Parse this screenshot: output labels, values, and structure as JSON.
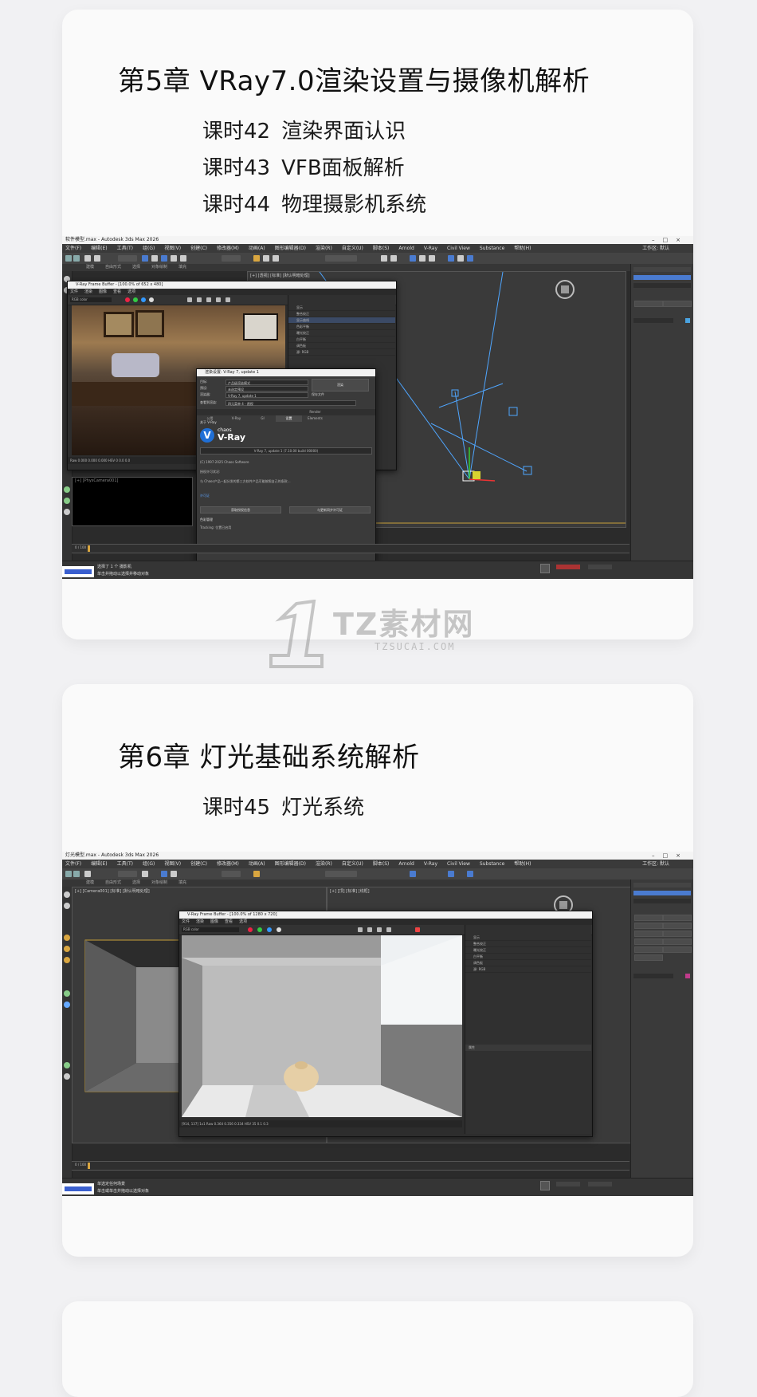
{
  "chapter5": {
    "title": "第5章 VRay7.0渲染设置与摄像机解析",
    "lessons": [
      {
        "num": "课时42",
        "name": "渲染界面认识"
      },
      {
        "num": "课时43",
        "name": "VFB面板解析"
      },
      {
        "num": "课时44",
        "name": "物理摄影机系统"
      }
    ],
    "screenshot": {
      "window_title": "软件模型.max - Autodesk 3ds Max 2026",
      "menu": [
        "文件(F)",
        "编辑(E)",
        "工具(T)",
        "组(G)",
        "视图(V)",
        "创建(C)",
        "修改器(M)",
        "动画(A)",
        "图形编辑器(D)",
        "渲染(R)",
        "自定义(U)",
        "脚本(S)",
        "Arnold",
        "V-Ray",
        "Civil View",
        "Substance",
        "帮助(H)"
      ],
      "workspace": "工作区: 默认",
      "subtabs": [
        "建模",
        "自由形式",
        "选择",
        "对象绘制",
        "填充"
      ],
      "vfb": {
        "title": "V-Ray Frame Buffer - [100.0% of 652 x 480]",
        "menu": [
          "文件",
          "渲染",
          "图像",
          "查看",
          "选项"
        ],
        "rgb": "RGB color",
        "layers": [
          "显示",
          "整合校正",
          "显示曲线",
          "色彩平衡",
          "曝光校正",
          "白平衡",
          "调色板",
          "源: RGB"
        ],
        "status": "Raw  0.000  0.000  0.000  HSV  0  0.0  0.0"
      },
      "render_dialog": {
        "title": "渲染设置: V-Ray 7, update 1",
        "target_label": "目标:",
        "target": "产品级渲染模式",
        "preset_label": "预设:",
        "preset": "未选定预设",
        "renderer_label": "渲染器:",
        "renderer": "V-Ray 7, update 1",
        "save_file": "保存文件",
        "view_label": "查看到渲染:",
        "view": "四元菜单 4 - 透视",
        "render_button": "渲染",
        "tabs": [
          "公用",
          "V-Ray",
          "GI",
          "设置",
          "Render Elements"
        ],
        "about_header": "关于 V-Ray",
        "logo_small": "chaos",
        "logo_big": "V-Ray",
        "version": "V-Ray 7, update 1 (7.10.00 build 00000)",
        "copyright": "(C) 1997-2025 Chaos Software",
        "license_title": "授权许可状况:",
        "license_text": "与 Chaos产品一起分发的第三方软件产品可能按照自己的条款…",
        "license_link": "许可证",
        "btn_left": "获取授权信息",
        "btn_right": "与更新同步许可证",
        "color_mgmt": "色彩管理",
        "tracing": "Tracking: 位置已启用"
      },
      "status": {
        "line1": "选择了 1 个 摄影机",
        "line2": "单击并拖动以选择并移动对象",
        "maxscript": "MAXScript 迷你侦听器",
        "timeline_start": "0 / 100"
      }
    }
  },
  "chapter6": {
    "title": "第6章 灯光基础系统解析",
    "lessons": [
      {
        "num": "课时45",
        "name": "灯光系统"
      }
    ],
    "screenshot": {
      "window_title": "灯光模型.max - Autodesk 3ds Max 2026",
      "menu": [
        "文件(F)",
        "编辑(E)",
        "工具(T)",
        "组(G)",
        "视图(V)",
        "创建(C)",
        "修改器(M)",
        "动画(A)",
        "图形编辑器(D)",
        "渲染(R)",
        "自定义(U)",
        "脚本(S)",
        "Arnold",
        "V-Ray",
        "Civil View",
        "Substance",
        "帮助(H)"
      ],
      "workspace": "工作区: 默认",
      "subtabs": [
        "建模",
        "自由形式",
        "选择",
        "对象绘制",
        "填充"
      ],
      "vfb": {
        "title": "V-Ray Frame Buffer - [100.0% of 1280 x 720]",
        "menu": [
          "文件",
          "渲染",
          "图像",
          "查看",
          "选项"
        ],
        "rgb": "RGB color",
        "layers": [
          "显示",
          "整合校正",
          "曝光校正",
          "白平衡",
          "调色板",
          "源: RGB"
        ],
        "properties": "属性",
        "status": "[914, 137]  1x1  Raw  0.364  0.356  0.334  HSV  35  0.1  0.3"
      },
      "status": {
        "line1": "单选定任何场景",
        "line2": "单击或单击并拖动以选择对象",
        "maxscript": "MAXScript 迷你侦听器",
        "timeline_start": "0 / 100"
      }
    }
  },
  "watermark": {
    "main": "TZ素材网",
    "sub": "TZSUCAI.COM"
  }
}
